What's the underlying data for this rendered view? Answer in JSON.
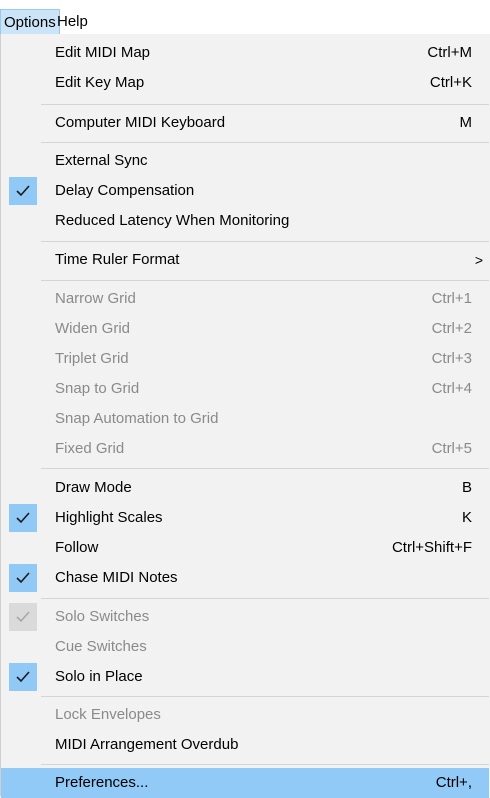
{
  "menubar": {
    "options": "Options",
    "help": "Help"
  },
  "colors": {
    "check_bg": "#90c8f6",
    "hover_bg": "#91c9f7",
    "disabled_text": "#8a8a8a"
  },
  "menu": {
    "edit_midi_map": {
      "label": "Edit MIDI Map",
      "accel": "Ctrl+M"
    },
    "edit_key_map": {
      "label": "Edit Key Map",
      "accel": "Ctrl+K"
    },
    "computer_midi_keyboard": {
      "label": "Computer MIDI Keyboard",
      "accel": "M"
    },
    "external_sync": {
      "label": "External Sync"
    },
    "delay_compensation": {
      "label": "Delay Compensation",
      "checked": true
    },
    "reduced_latency": {
      "label": "Reduced Latency When Monitoring"
    },
    "time_ruler_format": {
      "label": "Time Ruler Format",
      "submenu": ">"
    },
    "narrow_grid": {
      "label": "Narrow Grid",
      "accel": "Ctrl+1",
      "disabled": true
    },
    "widen_grid": {
      "label": "Widen Grid",
      "accel": "Ctrl+2",
      "disabled": true
    },
    "triplet_grid": {
      "label": "Triplet Grid",
      "accel": "Ctrl+3",
      "disabled": true
    },
    "snap_to_grid": {
      "label": "Snap to Grid",
      "accel": "Ctrl+4",
      "disabled": true
    },
    "snap_automation": {
      "label": "Snap Automation to Grid",
      "disabled": true
    },
    "fixed_grid": {
      "label": "Fixed Grid",
      "accel": "Ctrl+5",
      "disabled": true
    },
    "draw_mode": {
      "label": "Draw Mode",
      "accel": "B"
    },
    "highlight_scales": {
      "label": "Highlight Scales",
      "accel": "K",
      "checked": true
    },
    "follow": {
      "label": "Follow",
      "accel": "Ctrl+Shift+F"
    },
    "chase_midi_notes": {
      "label": "Chase MIDI Notes",
      "checked": true
    },
    "solo_switches": {
      "label": "Solo Switches",
      "checked": true,
      "disabled": true
    },
    "cue_switches": {
      "label": "Cue Switches",
      "disabled": true
    },
    "solo_in_place": {
      "label": "Solo in Place",
      "checked": true
    },
    "lock_envelopes": {
      "label": "Lock Envelopes",
      "disabled": true
    },
    "midi_arrangement_overdub": {
      "label": "MIDI Arrangement Overdub"
    },
    "preferences": {
      "label": "Preferences...",
      "accel": "Ctrl+,",
      "highlighted": true
    }
  }
}
